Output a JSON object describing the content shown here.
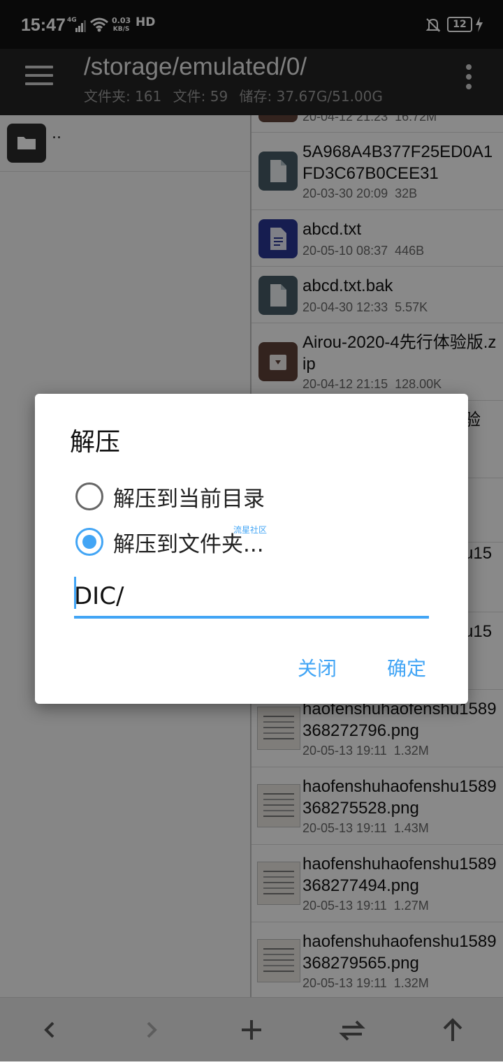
{
  "status_bar": {
    "time": "15:47",
    "network": "4G",
    "speed_value": "0.03",
    "speed_unit": "KB/S",
    "hd": "HD",
    "battery": "12"
  },
  "toolbar": {
    "path": "/storage/emulated/0/",
    "folders": "文件夹: 161",
    "files": "文件: 59",
    "storage": "储存: 37.67G/51.00G"
  },
  "left_pane": {
    "parent_label": ".."
  },
  "files": [
    {
      "name": "",
      "date": "20-04-12 21:23",
      "size": "16.72M",
      "icon": "archive-icon",
      "color": "#5d4037"
    },
    {
      "name": "5A968A4B377F25ED0A1FD3C67B0CEE31",
      "date": "20-03-30 20:09",
      "size": "32B",
      "icon": "file-icon",
      "color": "#455a64"
    },
    {
      "name": "abcd.txt",
      "date": "20-05-10 08:37",
      "size": "446B",
      "icon": "text-file-icon",
      "color": "#283593"
    },
    {
      "name": "abcd.txt.bak",
      "date": "20-04-30 12:33",
      "size": "5.57K",
      "icon": "file-icon",
      "color": "#455a64"
    },
    {
      "name": "Airou-2020-4先行体验版.zip",
      "date": "20-04-12 21:15",
      "size": "128.00K",
      "icon": "archive-icon",
      "color": "#5d4037"
    },
    {
      "name": "haofenshuhaofenshu1589368272796.png",
      "date": "20-05-13 19:11",
      "size": "1.32M",
      "icon": "image-thumbnail"
    },
    {
      "name": "haofenshuhaofenshu1589368275528.png",
      "date": "20-05-13 19:11",
      "size": "1.43M",
      "icon": "image-thumbnail"
    },
    {
      "name": "haofenshuhaofenshu1589368277494.png",
      "date": "20-05-13 19:11",
      "size": "1.27M",
      "icon": "image-thumbnail"
    },
    {
      "name": "haofenshuhaofenshu1589368279565.png",
      "date": "20-05-13 19:11",
      "size": "1.32M",
      "icon": "image-thumbnail"
    }
  ],
  "partial_text": {
    "behind_1": "验",
    "behind_2": "u15",
    "behind_3": "u15"
  },
  "dialog": {
    "title": "解压",
    "option_current": "解压到当前目录",
    "option_folder": "解压到文件夹...",
    "selected": "option_folder",
    "watermark": "流星社区",
    "input_value": "DIC/",
    "close_label": "关闭",
    "confirm_label": "确定",
    "accent_color": "#42a5f5"
  },
  "bottom_bar": {
    "buttons": [
      "back-icon",
      "forward-icon",
      "add-icon",
      "swap-icon",
      "up-icon"
    ]
  }
}
